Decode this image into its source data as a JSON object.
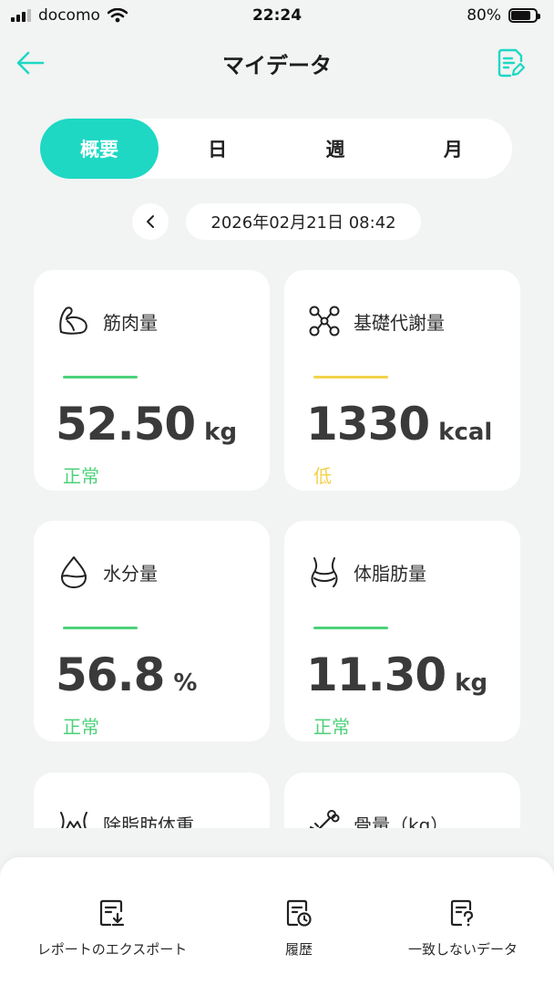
{
  "status_bar": {
    "carrier": "docomo",
    "time": "22:24",
    "battery": "80%",
    "battery_level": 0.8
  },
  "header": {
    "title": "マイデータ"
  },
  "segments": [
    {
      "label": "概要",
      "active": true
    },
    {
      "label": "日",
      "active": false
    },
    {
      "label": "週",
      "active": false
    },
    {
      "label": "月",
      "active": false
    }
  ],
  "date": {
    "text": "2026年02月21日 08:42"
  },
  "colors": {
    "accent": "#1ed8c4",
    "normal": "#4cd17a",
    "low": "#f2d24a"
  },
  "cards": [
    {
      "title": "筋肉量",
      "value": "52.50",
      "unit": "kg",
      "status": "正常",
      "icon": "muscle-icon"
    },
    {
      "title": "基礎代謝量",
      "value": "1330",
      "unit": "kcal",
      "status": "低",
      "icon": "metabolism-icon"
    },
    {
      "title": "水分量",
      "value": "56.8",
      "unit": "%",
      "status": "正常",
      "icon": "water-drop-icon"
    },
    {
      "title": "体脂肪量",
      "value": "11.30",
      "unit": "kg",
      "status": "正常",
      "icon": "body-fat-icon"
    },
    {
      "title": "除脂肪体重",
      "icon": "lean-mass-icon"
    },
    {
      "title": "骨量（kg）",
      "icon": "bone-icon"
    }
  ],
  "bottom_bar": {
    "export_label": "レポートのエクスポート",
    "history_label": "履歴",
    "mismatch_label": "一致しないデータ"
  }
}
